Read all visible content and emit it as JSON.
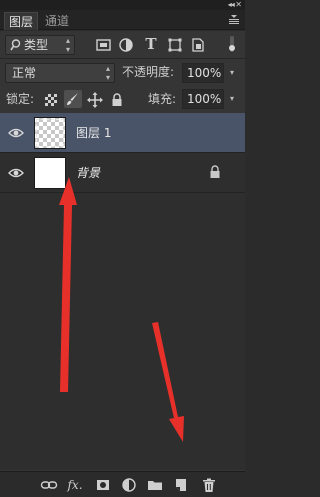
{
  "tabs": [
    {
      "label": "图层",
      "active": true
    },
    {
      "label": "通道",
      "active": false
    }
  ],
  "filter": {
    "label": "类型",
    "icon": "search-icon"
  },
  "filter_icons": [
    "image-filter-icon",
    "adjustment-filter-icon",
    "type-filter-icon",
    "shape-filter-icon",
    "smart-object-filter-icon",
    "filter-toggle-icon"
  ],
  "blend": {
    "mode": "正常",
    "opacity_label": "不透明度:",
    "opacity_value": "100%"
  },
  "lock": {
    "label": "锁定:",
    "fill_label": "填充:",
    "fill_value": "100%"
  },
  "layers": [
    {
      "name": "图层 1",
      "selected": true,
      "visible": true,
      "thumb": "transparent"
    },
    {
      "name": "背景",
      "selected": false,
      "visible": true,
      "thumb": "white",
      "locked": true
    }
  ],
  "bottom_icons": [
    "link-layers-icon",
    "layer-style-icon",
    "layer-mask-icon",
    "adjustment-layer-icon",
    "new-group-icon",
    "new-layer-icon",
    "delete-layer-icon"
  ],
  "colors": {
    "panel": "#353535",
    "layers_bg": "#2e2e2e",
    "selected": "#4a5468",
    "annotation_arrow": "#e8302a"
  }
}
